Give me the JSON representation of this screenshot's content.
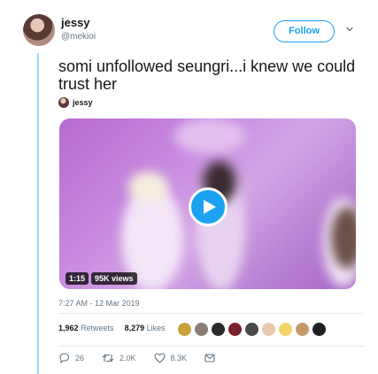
{
  "user": {
    "name": "jessy",
    "handle": "@mekioi",
    "avatar_icon": "user-avatar"
  },
  "follow_label": "Follow",
  "tweet_text": "somi unfollowed seungri...i knew we could trust her",
  "quoted_user": {
    "name": "jessy"
  },
  "media": {
    "duration": "1:15",
    "views": "95K views",
    "play_icon": "play-icon"
  },
  "timestamp": "7:27 AM - 12 Mar 2019",
  "stats": {
    "retweets_count": "1,962",
    "retweets_label": "Retweets",
    "likes_count": "8,279",
    "likes_label": "Likes"
  },
  "actions": {
    "reply_count": "26",
    "retweet_count": "2.0K",
    "like_count": "8.3K"
  },
  "colors": {
    "accent": "#1da1f2",
    "muted": "#657786",
    "text": "#14171a"
  }
}
